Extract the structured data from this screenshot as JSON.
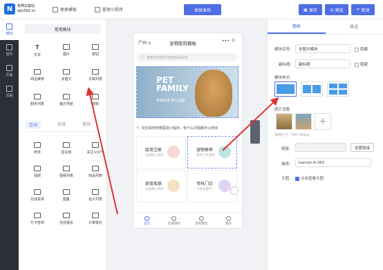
{
  "logo": {
    "mark": "N",
    "line1": "有啊云建站",
    "line2": "qdy592.cn"
  },
  "topbar": {
    "template_label": "更换模板",
    "miniapp_label": "管理小程序",
    "publish_label": "审核发布",
    "save_label": "保存",
    "preview_label": "预览",
    "cancel_label": "取消"
  },
  "leftnav": [
    {
      "label": "模块"
    },
    {
      "label": "插件"
    },
    {
      "label": "页面"
    },
    {
      "label": "风格"
    }
  ],
  "panel": {
    "common_title": "常用模块",
    "common_items": [
      {
        "label": "文本"
      },
      {
        "label": "图片"
      },
      {
        "label": "按钮"
      },
      {
        "label": "商品推荐"
      },
      {
        "label": "多图文"
      },
      {
        "label": "文章列表"
      },
      {
        "label": "服务列表"
      },
      {
        "label": "魔方导航"
      },
      {
        "label": "视频"
      }
    ],
    "tabs": [
      {
        "label": "互动"
      },
      {
        "label": "商城"
      },
      {
        "label": "营销"
      }
    ],
    "interact_items": [
      {
        "label": "表单"
      },
      {
        "label": "留言板"
      },
      {
        "label": "关注公众号"
      },
      {
        "label": "视频"
      },
      {
        "label": "视频列表"
      },
      {
        "label": "商品列表"
      },
      {
        "label": "在线投票"
      },
      {
        "label": "图集"
      },
      {
        "label": "名片列表"
      },
      {
        "label": "打卡签到"
      },
      {
        "label": "在线报名"
      },
      {
        "label": "计算报价"
      }
    ]
  },
  "phone": {
    "city": "广州",
    "title": "宠物医院模板",
    "search_placeholder": "搜索您需要的宠物相关服务",
    "banner_line1": "PET",
    "banner_line2": "FAMILY",
    "banner_sub": "宠物关爱 放心选择",
    "notice": "欢迎来到宠物医院小程序，有什么问题都可以咨询",
    "cards": [
      {
        "title": "疫苗注射",
        "sub": "为您精心呵护"
      },
      {
        "title": "宠物寄养",
        "sub": "暂停工作寄养"
      },
      {
        "title": "绝育疾病",
        "sub": "为您精心呵护"
      },
      {
        "title": "专科门诊",
        "sub": "个性化服务"
      }
    ],
    "tabs": [
      {
        "label": "首页"
      },
      {
        "label": "在线预约"
      },
      {
        "label": "宠物课堂"
      },
      {
        "label": "我的"
      }
    ]
  },
  "right": {
    "tabs": [
      {
        "label": "基础"
      },
      {
        "label": "样式"
      }
    ],
    "module_name_label": "模块名称:",
    "module_name_value": "多图文模块",
    "hide1": "隐藏",
    "subtitle_label": "副标题:",
    "subtitle_value": "副标题",
    "hide2": "隐藏",
    "style_label": "模块样式:",
    "image_label": "图片设置:",
    "image_hint": "推荐尺寸: 750*384px",
    "link_label": "链接:",
    "link_button": "设置链接",
    "desc_label": "描述:",
    "desc_value": "banner-A-360",
    "bigimg_label": "大图:",
    "bigimg_check": "点击查看大图"
  },
  "colors": {
    "accent": "#4e6ee5",
    "sidebar": "#2a2f3a",
    "arrow": "#e03333"
  }
}
